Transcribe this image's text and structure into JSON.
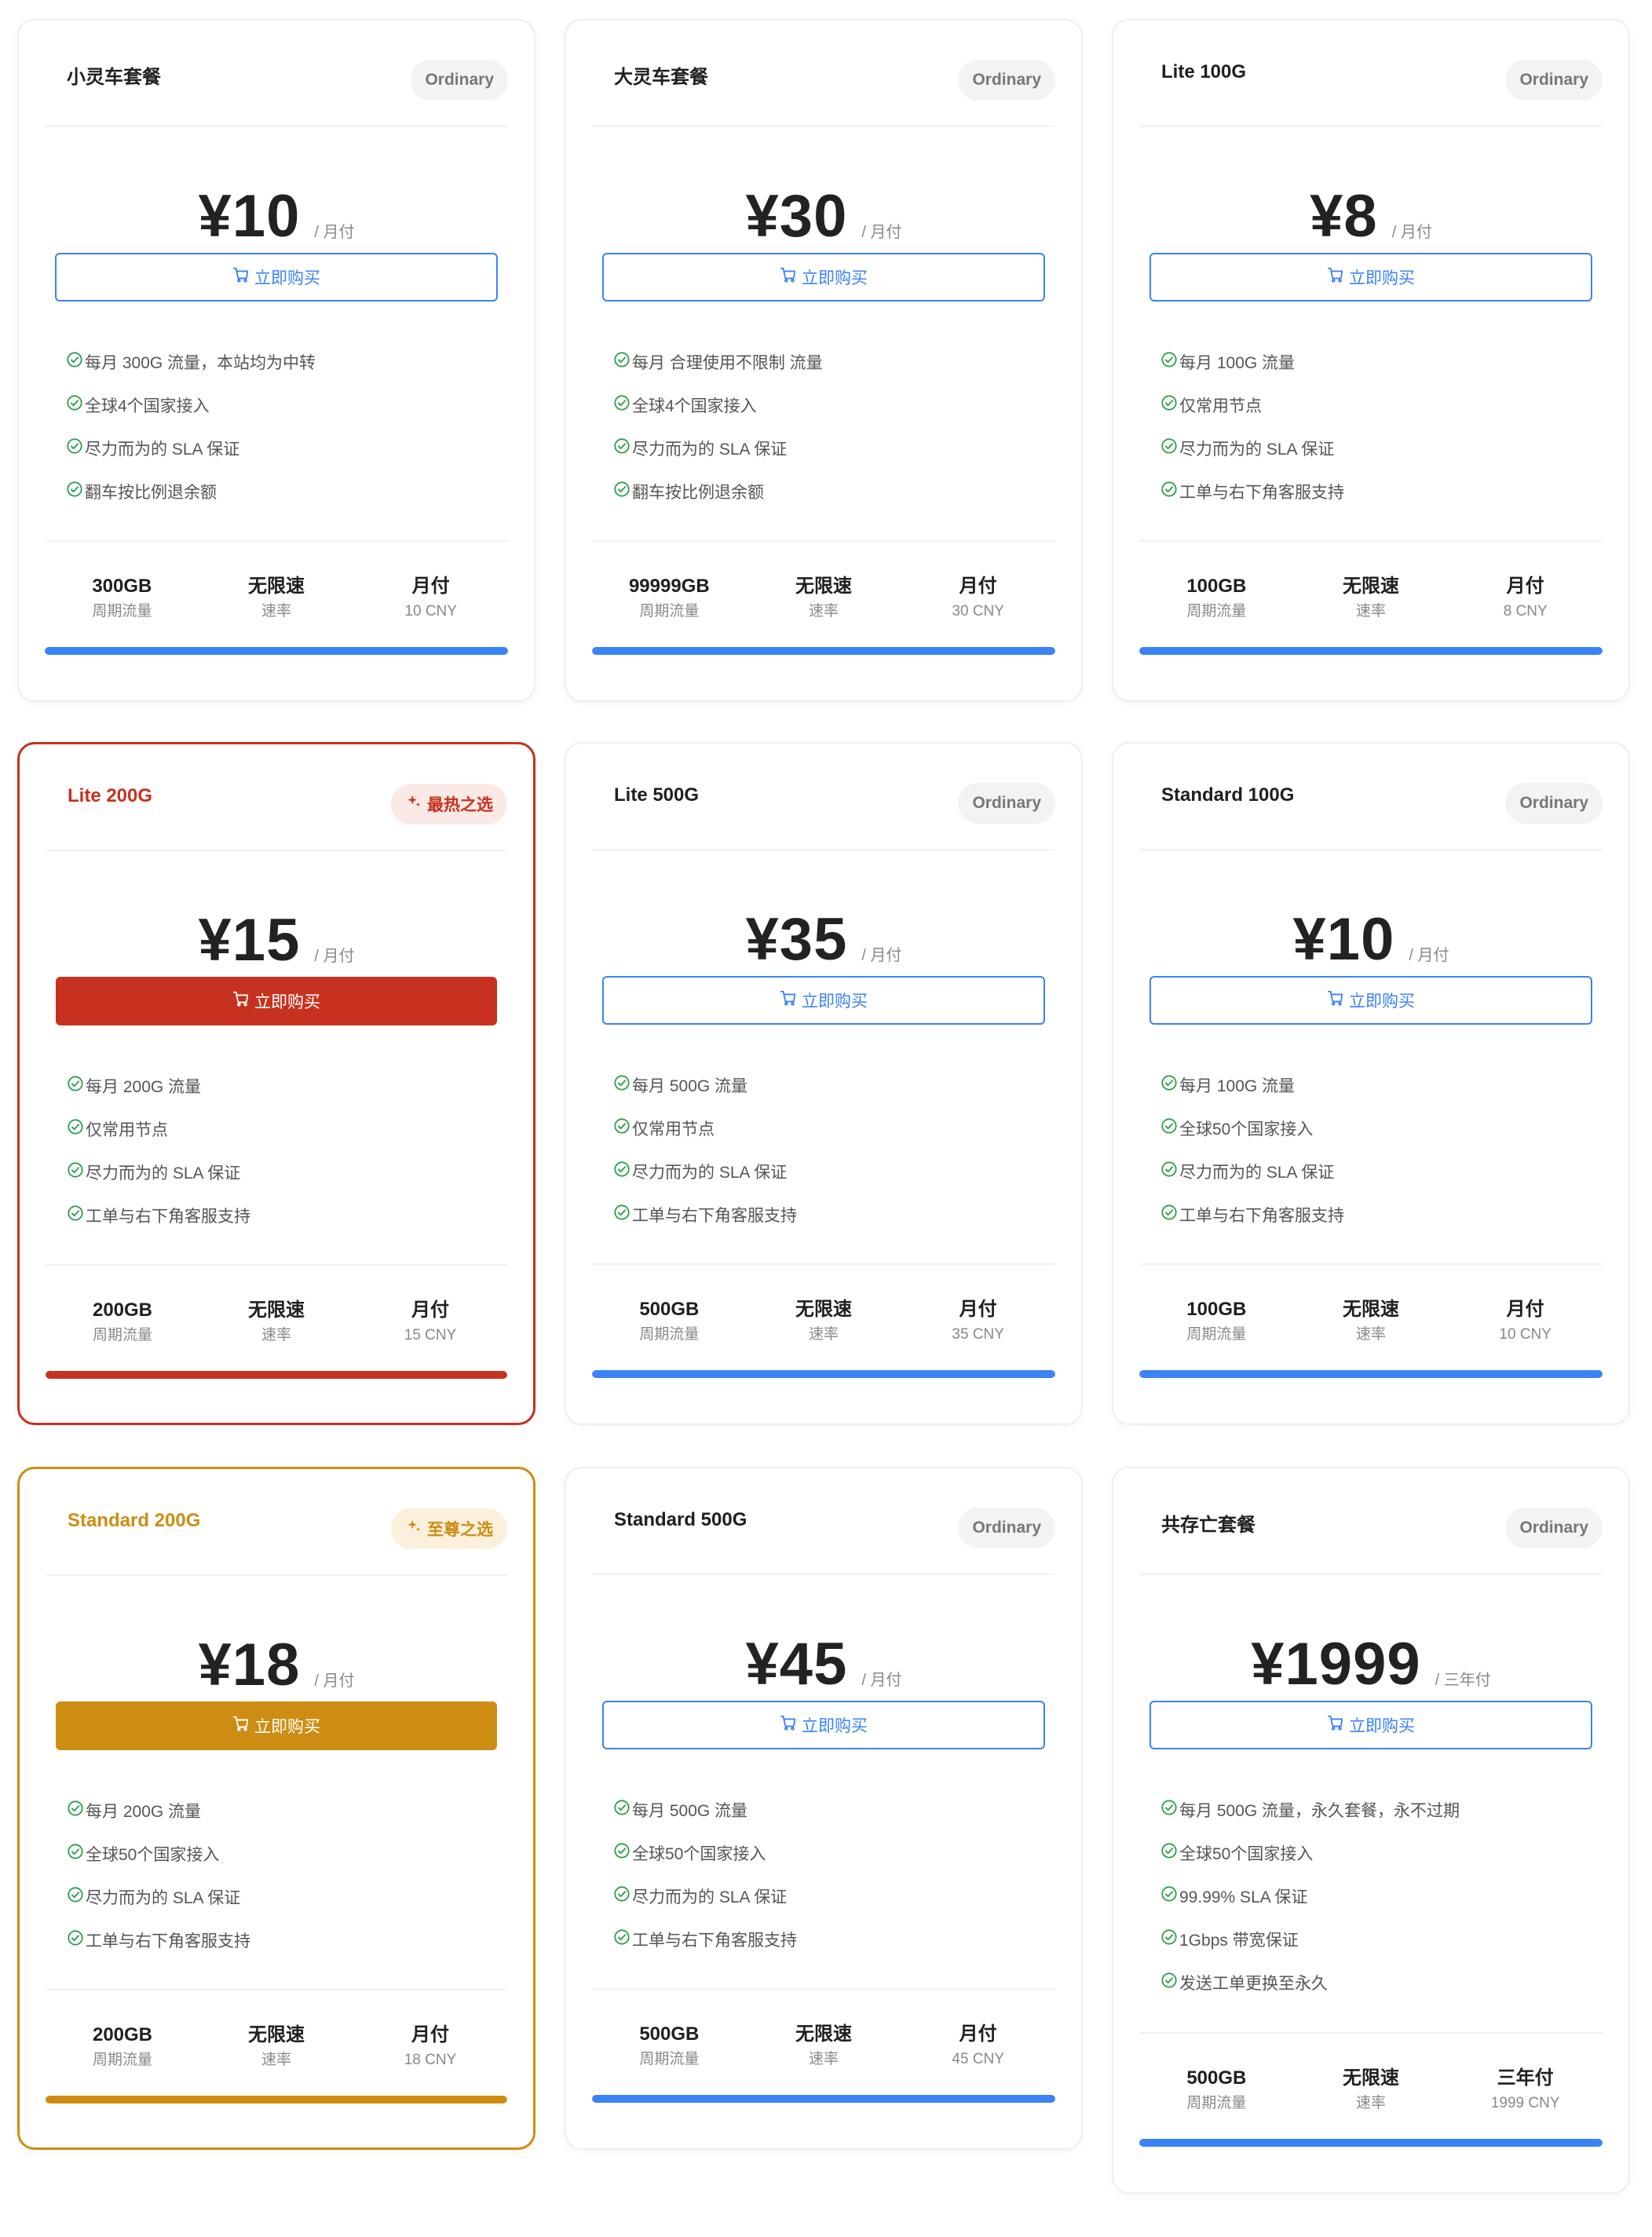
{
  "plans": [
    {
      "name": "小灵车套餐",
      "badge": "Ordinary",
      "price": "¥10",
      "period": "/ 月付",
      "buy_label": "立即购买",
      "features": [
        "每月 300G 流量，本站均为中转",
        "全球4个国家接入",
        "尽力而为的 SLA 保证",
        "翻车按比例退余额"
      ],
      "stats": [
        {
          "value": "300GB",
          "label": "周期流量"
        },
        {
          "value": "无限速",
          "label": "速率"
        },
        {
          "value": "月付",
          "label": "10 CNY"
        }
      ],
      "progress": 1.0
    },
    {
      "name": "大灵车套餐",
      "badge": "Ordinary",
      "price": "¥30",
      "period": "/ 月付",
      "buy_label": "立即购买",
      "features": [
        "每月 合理使用不限制 流量",
        "全球4个国家接入",
        "尽力而为的 SLA 保证",
        "翻车按比例退余额"
      ],
      "stats": [
        {
          "value": "99999GB",
          "label": "周期流量"
        },
        {
          "value": "无限速",
          "label": "速率"
        },
        {
          "value": "月付",
          "label": "30 CNY"
        }
      ],
      "progress": 1.0
    },
    {
      "name": "Lite 100G",
      "badge": "Ordinary",
      "price": "¥8",
      "period": "/ 月付",
      "buy_label": "立即购买",
      "features": [
        "每月 100G 流量",
        "仅常用节点",
        "尽力而为的 SLA 保证",
        "工单与右下角客服支持"
      ],
      "stats": [
        {
          "value": "100GB",
          "label": "周期流量"
        },
        {
          "value": "无限速",
          "label": "速率"
        },
        {
          "value": "月付",
          "label": "8 CNY"
        }
      ],
      "progress": 1.0
    },
    {
      "name": "Lite 200G",
      "badge": "最热之选",
      "price": "¥15",
      "period": "/ 月付",
      "buy_label": "立即购买",
      "features": [
        "每月 200G 流量",
        "仅常用节点",
        "尽力而为的 SLA 保证",
        "工单与右下角客服支持"
      ],
      "stats": [
        {
          "value": "200GB",
          "label": "周期流量"
        },
        {
          "value": "无限速",
          "label": "速率"
        },
        {
          "value": "月付",
          "label": "15 CNY"
        }
      ],
      "progress": 1.0
    },
    {
      "name": "Lite 500G",
      "badge": "Ordinary",
      "price": "¥35",
      "period": "/ 月付",
      "buy_label": "立即购买",
      "features": [
        "每月 500G 流量",
        "仅常用节点",
        "尽力而为的 SLA 保证",
        "工单与右下角客服支持"
      ],
      "stats": [
        {
          "value": "500GB",
          "label": "周期流量"
        },
        {
          "value": "无限速",
          "label": "速率"
        },
        {
          "value": "月付",
          "label": "35 CNY"
        }
      ],
      "progress": 1.0
    },
    {
      "name": "Standard 100G",
      "badge": "Ordinary",
      "price": "¥10",
      "period": "/ 月付",
      "buy_label": "立即购买",
      "features": [
        "每月 100G 流量",
        "全球50个国家接入",
        "尽力而为的 SLA 保证",
        "工单与右下角客服支持"
      ],
      "stats": [
        {
          "value": "100GB",
          "label": "周期流量"
        },
        {
          "value": "无限速",
          "label": "速率"
        },
        {
          "value": "月付",
          "label": "10 CNY"
        }
      ],
      "progress": 1.0
    },
    {
      "name": "Standard 200G",
      "badge": "至尊之选",
      "price": "¥18",
      "period": "/ 月付",
      "buy_label": "立即购买",
      "features": [
        "每月 200G 流量",
        "全球50个国家接入",
        "尽力而为的 SLA 保证",
        "工单与右下角客服支持"
      ],
      "stats": [
        {
          "value": "200GB",
          "label": "周期流量"
        },
        {
          "value": "无限速",
          "label": "速率"
        },
        {
          "value": "月付",
          "label": "18 CNY"
        }
      ],
      "progress": 1.0
    },
    {
      "name": "Standard 500G",
      "badge": "Ordinary",
      "price": "¥45",
      "period": "/ 月付",
      "buy_label": "立即购买",
      "features": [
        "每月 500G 流量",
        "全球50个国家接入",
        "尽力而为的 SLA 保证",
        "工单与右下角客服支持"
      ],
      "stats": [
        {
          "value": "500GB",
          "label": "周期流量"
        },
        {
          "value": "无限速",
          "label": "速率"
        },
        {
          "value": "月付",
          "label": "45 CNY"
        }
      ],
      "progress": 1.0
    },
    {
      "name": "共存亡套餐",
      "badge": "Ordinary",
      "price": "¥1999",
      "period": "/ 三年付",
      "buy_label": "立即购买",
      "features": [
        "每月 500G 流量，永久套餐，永不过期",
        "全球50个国家接入",
        "99.99% SLA 保证",
        "1Gbps 带宽保证",
        "发送工单更换至永久"
      ],
      "stats": [
        {
          "value": "500GB",
          "label": "周期流量"
        },
        {
          "value": "无限速",
          "label": "速率"
        },
        {
          "value": "三年付",
          "label": "1999 CNY"
        }
      ],
      "progress": 1.0
    }
  ],
  "icons": {
    "cart": "cart-icon",
    "check": "check-circle-icon",
    "sparkle": "sparkle-icon"
  },
  "colors": {
    "accent": "#3b82f6",
    "hot": "#c6321f",
    "gold": "#cd8d13",
    "check": "#2e9e4f"
  }
}
